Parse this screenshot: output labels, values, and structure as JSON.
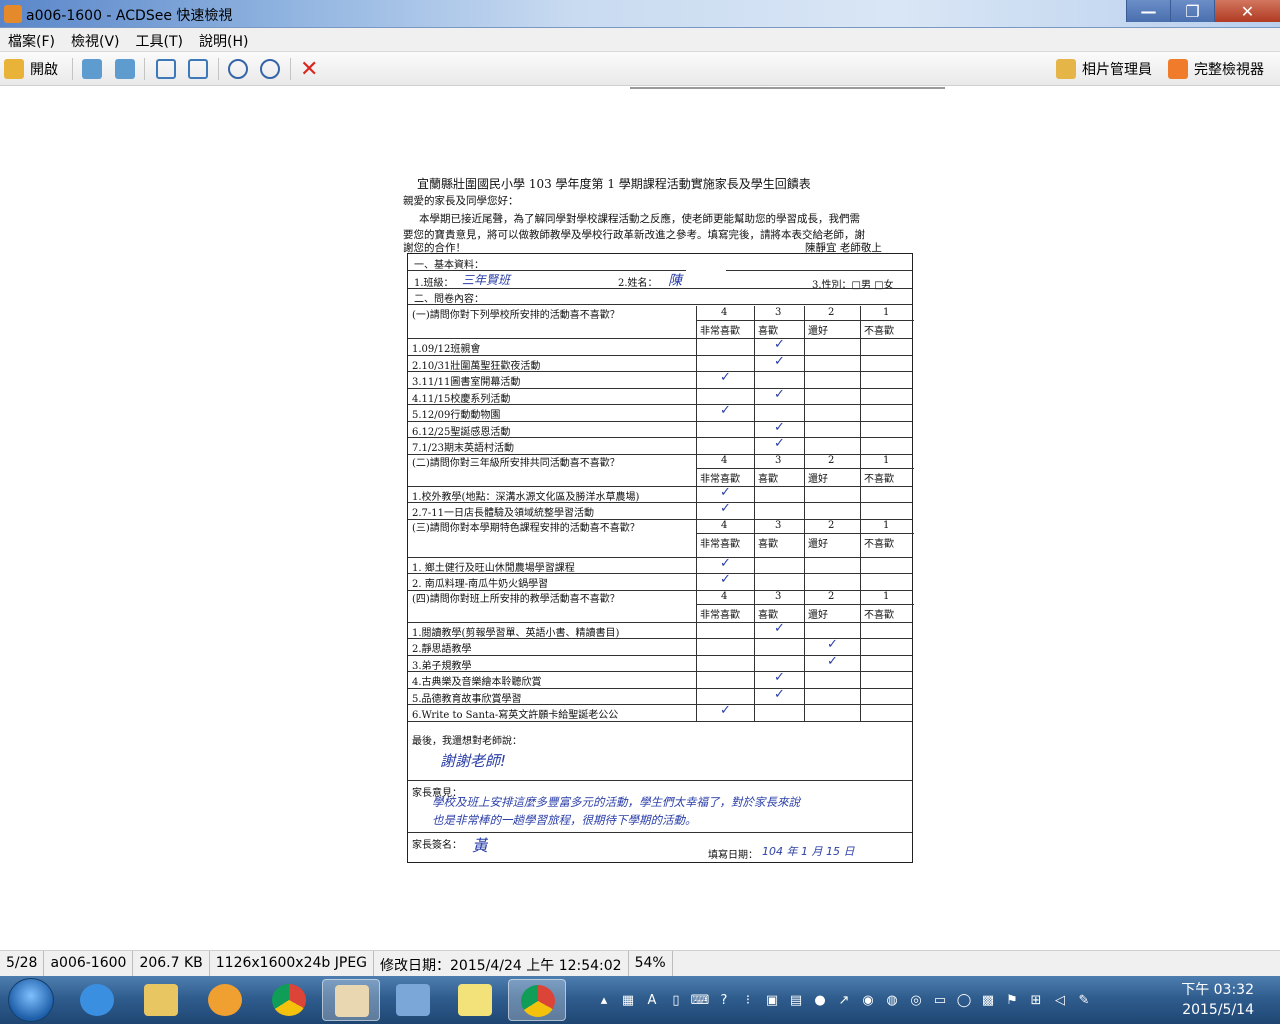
{
  "window": {
    "title": "a006-1600 - ACDSee 快速檢視",
    "controls": [
      "—",
      "❐",
      "✕"
    ]
  },
  "menu": [
    "檔案(F)",
    "檢視(V)",
    "工具(T)",
    "說明(H)"
  ],
  "toolbar": {
    "open_label": "開啟",
    "photo_manager_label": "相片管理員",
    "full_viewer_label": "完整檢視器"
  },
  "document": {
    "title": "宜蘭縣壯圍國民小學 103 學年度第 1 學期課程活動實施家長及學生回饋表",
    "greeting": "親愛的家長及同學您好：",
    "intro_1": "本學期已接近尾聲，為了解同學對學校課程活動之反應，使老師更能幫助您的學習成長，我們需",
    "intro_2": "要您的寶貴意見，將可以做教師教學及學校行政革新改進之參考。填寫完後，請將本表交給老師，謝",
    "intro_3": "謝您的合作！",
    "signer": "陳靜宜 老師敬上",
    "basic_info": "一、基本資料：",
    "class_label": "1.班級：",
    "class_value": "三年賢班",
    "name_label": "2.姓名：",
    "name_value": "陳",
    "gender_label": "3.性別：□男 □女",
    "questionnaire": "二、問卷內容：",
    "scale_nums": [
      "4",
      "3",
      "2",
      "1"
    ],
    "scale_labels": [
      "非常喜歡",
      "喜歡",
      "還好",
      "不喜歡"
    ],
    "sections": [
      {
        "question": "(一)請問你對下列學校所安排的活動喜不喜歡？",
        "items": [
          "1.09/12班親會",
          "2.10/31壯圍萬聖狂歡夜活動",
          "3.11/11圖書室開幕活動",
          "4.11/15校慶系列活動",
          "5.12/09行動動物園",
          "6.12/25聖誕感恩活動",
          "7.1/23期末英語村活動"
        ],
        "checks": [
          2,
          2,
          1,
          2,
          1,
          2,
          2
        ]
      },
      {
        "question": "(二)請問你對三年級所安排共同活動喜不喜歡？",
        "items": [
          "1.校外教學(地點：深溝水源文化區及勝洋水草農場)",
          "2.7-11一日店長體驗及領域統整學習活動"
        ],
        "checks": [
          1,
          1
        ]
      },
      {
        "question": "(三)請問你對本學期特色課程安排的活動喜不喜歡？",
        "items": [
          "1.  鄉土健行及旺山休閒農場學習課程",
          "2.  南瓜料理-南瓜牛奶火鍋學習"
        ],
        "checks": [
          1,
          1
        ]
      },
      {
        "question": "(四)請問你對班上所安排的教學活動喜不喜歡？",
        "items": [
          "1.閱讀教學(剪報學習單、英語小書、精讀書目)",
          "2.靜思語教學",
          "3.弟子規教學",
          "4.古典樂及音樂繪本聆聽欣賞",
          "5.品德教育故事欣賞學習",
          "6.Write to Santa-寫英文許願卡給聖誕老公公"
        ],
        "checks": [
          2,
          3,
          3,
          2,
          2,
          1
        ]
      }
    ],
    "last_words_label": "最後，我還想對老師說：",
    "last_words_value": "謝謝老師!",
    "parent_opinion_label": "家長意見：",
    "parent_opinion_1": "學校及班上安排這麼多豐富多元的活動，學生們太幸福了，對於家長來說",
    "parent_opinion_2": "也是非常棒的一趟學習旅程，很期待下學期的活動。",
    "parent_sign_label": "家長簽名：",
    "parent_sign_value": "黃",
    "date_label": "填寫日期：",
    "date_value": "104 年 1 月 15 日"
  },
  "status": {
    "position": "5/28",
    "filename": "a006-1600",
    "filesize": "206.7 KB",
    "dimensions": "1126x1600x24b JPEG",
    "modified": "修改日期：2015/4/24 上午 12:54:02",
    "zoom": "54%"
  },
  "taskbar": {
    "time": "下午 03:32",
    "date": "2015/5/14"
  }
}
